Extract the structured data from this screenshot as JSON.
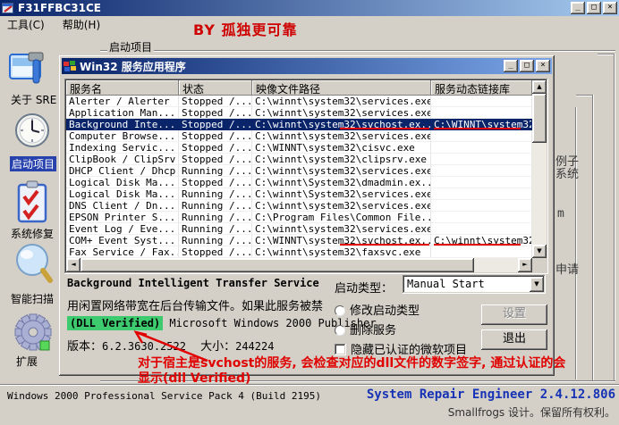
{
  "window": {
    "title": "F31FFBC31CE",
    "menu": {
      "tools": "工具(C)",
      "help": "帮助(H)"
    },
    "watermark": "BY 孤独更可靠",
    "groupbox_label": "启动项目"
  },
  "sidebar": {
    "items": [
      {
        "label": "关于 SRE"
      },
      {
        "label": "启动项目",
        "selected": true
      },
      {
        "label": "系统修复"
      },
      {
        "label": "智能扫描"
      },
      {
        "label": "扩展"
      }
    ]
  },
  "dialog": {
    "title": "Win32 服务应用程序",
    "table": {
      "columns": [
        "服务名",
        "状态",
        "映像文件路径",
        "服务动态链接库"
      ],
      "rows": [
        {
          "name": "Alerter / Alerter",
          "status": "Stopped /...",
          "path": "C:\\winnt\\system32\\services.exe",
          "dll": ""
        },
        {
          "name": "Application Man...",
          "status": "Stopped /...",
          "path": "C:\\winnt\\system32\\services.exe",
          "dll": ""
        },
        {
          "name": "Background Inte...",
          "status": "Stopped /...",
          "path": "C:\\winnt\\system32\\svchost.ex...",
          "dll": "C:\\WINNT\\system32",
          "selected": true,
          "underline": true
        },
        {
          "name": "Computer Browse...",
          "status": "Stopped /...",
          "path": "C:\\winnt\\system32\\services.exe",
          "dll": ""
        },
        {
          "name": "Indexing Servic...",
          "status": "Stopped /...",
          "path": "C:\\WINNT\\system32\\cisvc.exe",
          "dll": ""
        },
        {
          "name": "ClipBook / ClipSrv",
          "status": "Stopped /...",
          "path": "C:\\winnt\\system32\\clipsrv.exe",
          "dll": ""
        },
        {
          "name": "DHCP Client / Dhcp",
          "status": "Running /...",
          "path": "C:\\winnt\\system32\\services.exe",
          "dll": ""
        },
        {
          "name": "Logical Disk Ma...",
          "status": "Stopped /...",
          "path": "C:\\winnt\\System32\\dmadmin.ex...",
          "dll": ""
        },
        {
          "name": "Logical Disk Ma...",
          "status": "Running /...",
          "path": "C:\\winnt\\System32\\services.exe",
          "dll": ""
        },
        {
          "name": "DNS Client / Dn...",
          "status": "Running /...",
          "path": "C:\\winnt\\system32\\services.exe",
          "dll": ""
        },
        {
          "name": "EPSON Printer S...",
          "status": "Running /...",
          "path": "C:\\Program Files\\Common File...",
          "dll": ""
        },
        {
          "name": "Event Log / Eve...",
          "status": "Running /...",
          "path": "C:\\winnt\\system32\\services.exe",
          "dll": ""
        },
        {
          "name": "COM+ Event Syst...",
          "status": "Running /...",
          "path": "C:\\WINNT\\system32\\svchost.ex...",
          "dll": "C:\\winnt\\system32",
          "underline": true
        },
        {
          "name": "Fax Service / Fax...",
          "status": "Stopped /...",
          "path": "C:\\winnt\\system32\\faxsvc.exe",
          "dll": ""
        }
      ]
    },
    "details": {
      "service_name": "Background Intelligent Transfer Service",
      "description": "用闲置网络带宽在后台传输文件。如果此服务被禁",
      "verified_badge": "(DLL Verified)",
      "publisher": "Microsoft Windows 2000 Publisher",
      "version_label": "版本：",
      "version_value": "6.2.3630.2522",
      "size_label": "大小：",
      "size_value": "244224"
    },
    "controls": {
      "startup_type_label": "启动类型：",
      "startup_type_value": "Manual Start",
      "radio_modify_label": "修改启动类型",
      "radio_delete_label": "删除服务",
      "checkbox_hide_label": "隐藏已认证的微软项目",
      "settings_button": "设置",
      "exit_button": "退出"
    }
  },
  "annotation": {
    "line1": "对于宿主是svchost的服务, 会检查对应的dll文件的数字签字, 通过认证的会",
    "line2": "显示(dll Verified)"
  },
  "statusbar": {
    "os_version": "Windows 2000 Professional Service Pack 4 (Build 2195)",
    "app_name": "System Repair Engineer 2.4.12.806",
    "credit": "Smallfrogs 设计。保留所有权利。"
  },
  "background_fragments": [
    "例子",
    "系统",
    "m",
    "申请"
  ],
  "colors": {
    "titlebar_gradient_start": "#0a246a",
    "titlebar_gradient_end": "#a6caf0",
    "selection_navy": "#0a246a",
    "verified_green": "#3ecb6f",
    "annotation_red": "#e00000",
    "app_name_blue": "#1733b5",
    "chrome_gray": "#d4d0c8"
  }
}
